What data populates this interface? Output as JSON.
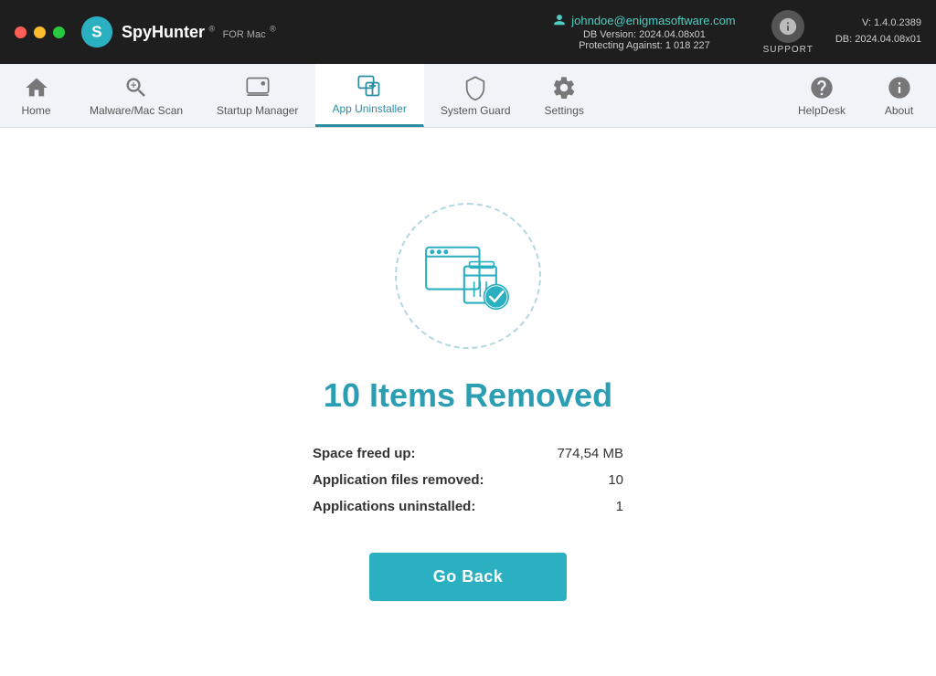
{
  "window": {
    "title": "SpyHunter for Mac"
  },
  "titlebar": {
    "email": "johndoe@enigmasoftware.com",
    "db_version": "DB Version: 2024.04.08x01",
    "protecting": "Protecting Against: 1 018 227",
    "support_label": "SUPPORT",
    "version": "V: 1.4.0.2389",
    "db_label": "DB:  2024.04.08x01"
  },
  "nav": {
    "items": [
      {
        "id": "home",
        "label": "Home"
      },
      {
        "id": "malware-scan",
        "label": "Malware/Mac Scan"
      },
      {
        "id": "startup-manager",
        "label": "Startup Manager"
      },
      {
        "id": "app-uninstaller",
        "label": "App Uninstaller"
      },
      {
        "id": "system-guard",
        "label": "System Guard"
      },
      {
        "id": "settings",
        "label": "Settings"
      }
    ],
    "right_items": [
      {
        "id": "helpdesk",
        "label": "HelpDesk"
      },
      {
        "id": "about",
        "label": "About"
      }
    ],
    "active": "app-uninstaller"
  },
  "main": {
    "title": "10 Items Removed",
    "stats": [
      {
        "label": "Space freed up:",
        "value": "774,54 MB"
      },
      {
        "label": "Application files removed:",
        "value": "10"
      },
      {
        "label": "Applications uninstalled:",
        "value": "1"
      }
    ],
    "button": "Go Back"
  },
  "colors": {
    "accent": "#2ab0c0",
    "accent_dark": "#1d9aaa",
    "title_color": "#2b9eb3"
  }
}
